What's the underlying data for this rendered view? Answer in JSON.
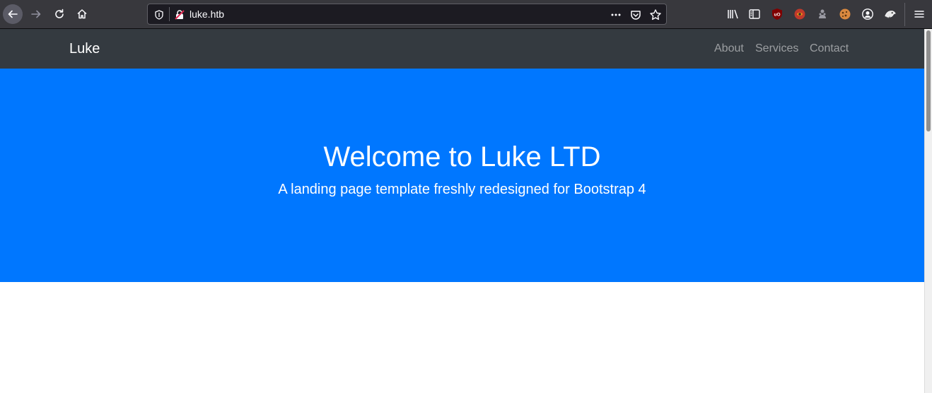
{
  "browser": {
    "url": "luke.htb",
    "toolbar_icons": [
      "back-icon",
      "forward-icon",
      "reload-icon",
      "home-icon",
      "tracking-shield-icon",
      "insecure-lock-icon",
      "more-dots-icon",
      "pocket-icon",
      "bookmark-star-icon",
      "library-icon",
      "sidebar-icon",
      "ublock-origin-icon",
      "extension-icon",
      "extension-icon",
      "cookie-icon",
      "account-icon",
      "extension-icon",
      "hamburger-menu-icon"
    ],
    "ublock_badge": "uO"
  },
  "site": {
    "brand": "Luke",
    "nav": {
      "about": "About",
      "services": "Services",
      "contact": "Contact"
    },
    "hero": {
      "title": "Welcome to Luke LTD",
      "subtitle": "A landing page template freshly redesigned for Bootstrap 4"
    }
  },
  "colors": {
    "navbar": "#343a40",
    "hero_background": "#0077ff",
    "browser_chrome": "#38383d",
    "url_bar": "#1c1b22"
  }
}
